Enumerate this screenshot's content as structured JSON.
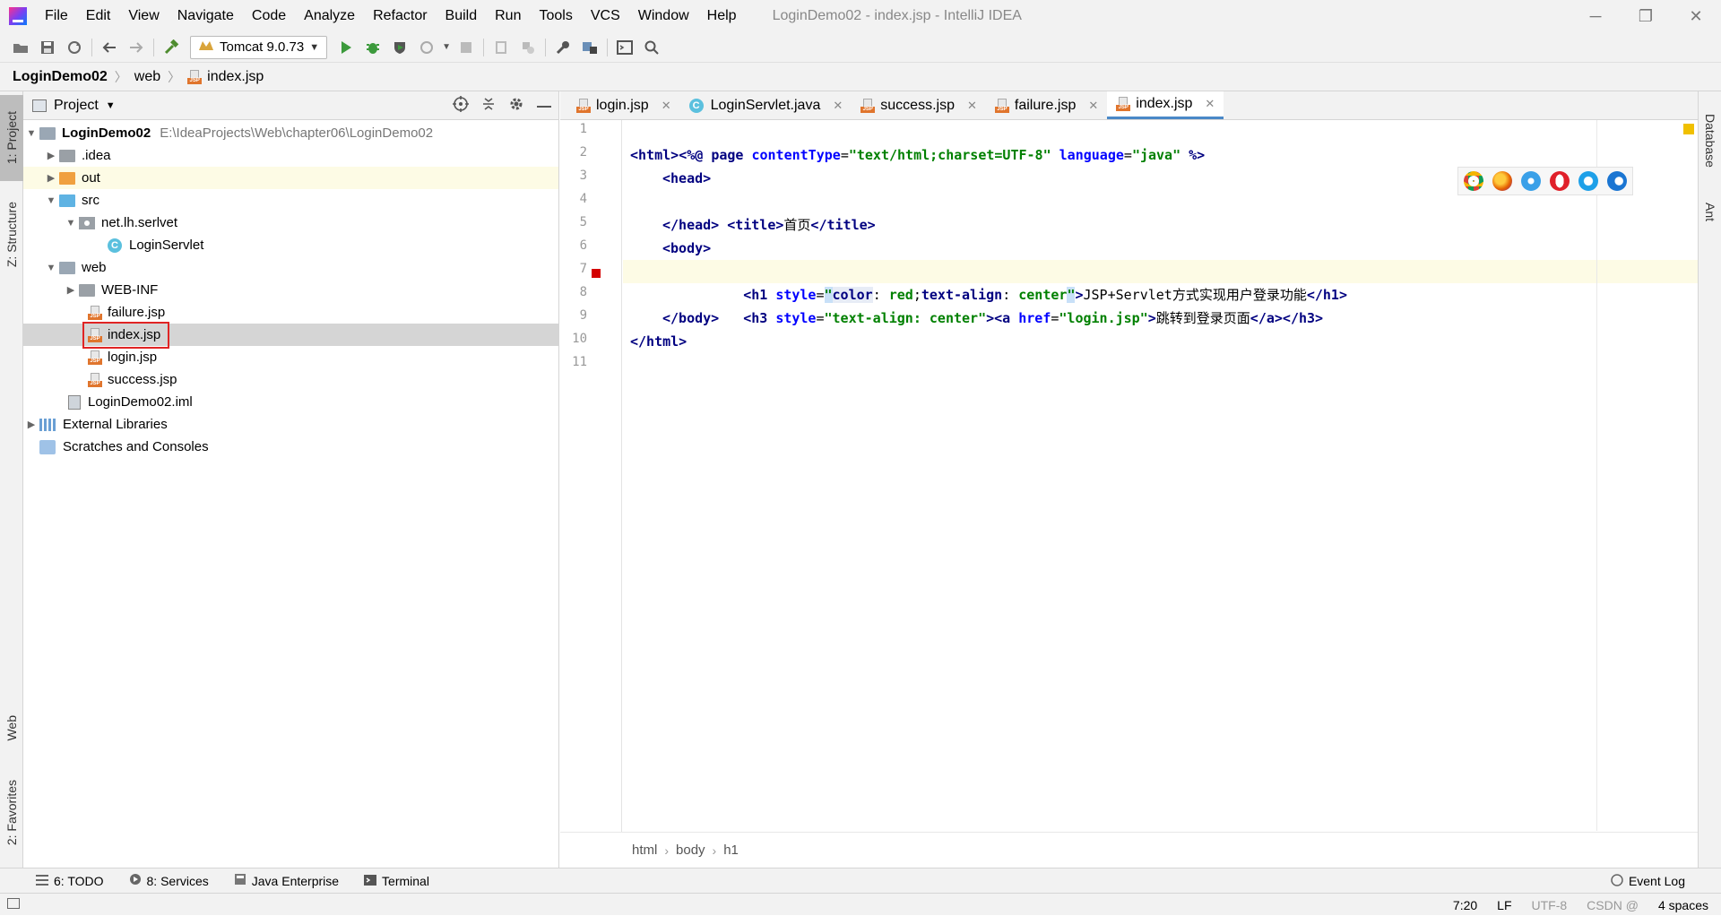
{
  "window": {
    "title": "LoginDemo02 - index.jsp - IntelliJ IDEA",
    "controls": [
      "─",
      "❐",
      "✕"
    ]
  },
  "menu": [
    "File",
    "Edit",
    "View",
    "Navigate",
    "Code",
    "Analyze",
    "Refactor",
    "Build",
    "Run",
    "Tools",
    "VCS",
    "Window",
    "Help"
  ],
  "toolbar": {
    "run_config": "Tomcat 9.0.73"
  },
  "breadcrumb": {
    "project": "LoginDemo02",
    "folder": "web",
    "file": "index.jsp"
  },
  "left_tabs": {
    "project": "1: Project",
    "structure": "Z: Structure",
    "web": "Web",
    "favorites": "2: Favorites"
  },
  "right_tabs": {
    "database": "Database",
    "ant": "Ant"
  },
  "project_panel": {
    "title": "Project",
    "tree": {
      "root": "LoginDemo02",
      "root_path": "E:\\IdeaProjects\\Web\\chapter06\\LoginDemo02",
      "idea": ".idea",
      "out": "out",
      "src": "src",
      "package": "net.lh.serlvet",
      "servlet": "LoginServlet",
      "web": "web",
      "webinf": "WEB-INF",
      "failure": "failure.jsp",
      "index": "index.jsp",
      "login": "login.jsp",
      "success": "success.jsp",
      "iml": "LoginDemo02.iml",
      "libraries": "External Libraries",
      "scratches": "Scratches and Consoles"
    }
  },
  "tabs": [
    "login.jsp",
    "LoginServlet.java",
    "success.jsp",
    "failure.jsp",
    "index.jsp"
  ],
  "tab_letters": {
    "jsp": "JSP",
    "java": "C"
  },
  "code": {
    "l1": {
      "a": "<%@ ",
      "b": "page ",
      "c": "contentType",
      "d": "=",
      "e": "\"text/html;charset=UTF-8\"",
      "f": " ",
      "g": "language",
      "h": "=",
      "i": "\"java\"",
      "j": " %>"
    },
    "l2": "<html>",
    "l3": "<head>",
    "l4": {
      "a": "<title>",
      "b": "首页",
      "c": "</title>"
    },
    "l5": "</head>",
    "l6": "<body>",
    "l7": {
      "a": "<h1 ",
      "b": "style",
      "c": "=",
      "d": "\"",
      "e": "color",
      "f": ": ",
      "g": "red",
      "h": ";",
      "i": "text-align",
      "j": ": ",
      "k": "center",
      "l": "\"",
      "m": ">",
      "n": "JSP+Servlet方式实现用户登录功能",
      "o": "</h1>"
    },
    "l8": {
      "a": "<h3 ",
      "b": "style",
      "c": "=",
      "d": "\"text-align: center\"",
      "e": "><a ",
      "f": "href",
      "g": "=",
      "h": "\"login.jsp\"",
      "i": ">",
      "j": "跳转到登录页面",
      "k": "</a></h3>"
    },
    "l9": "</body>",
    "l10": "</html>"
  },
  "line_numbers": [
    "1",
    "2",
    "3",
    "4",
    "5",
    "6",
    "7",
    "8",
    "9",
    "10",
    "11"
  ],
  "editor_breadcrumb": [
    "html",
    "body",
    "h1"
  ],
  "bottom_tabs": {
    "todo": "6: TODO",
    "services": "8: Services",
    "java_enterprise": "Java Enterprise",
    "terminal": "Terminal",
    "event_log": "Event Log"
  },
  "status": {
    "position": "7:20",
    "line_sep": "LF",
    "encoding": "UTF-8",
    "indent": "4 spaces",
    "watermark": "CSDN @"
  },
  "colors": {
    "accent": "#4a88c7",
    "highlight": "#e02424",
    "jsp_badge": "#e0752d"
  }
}
